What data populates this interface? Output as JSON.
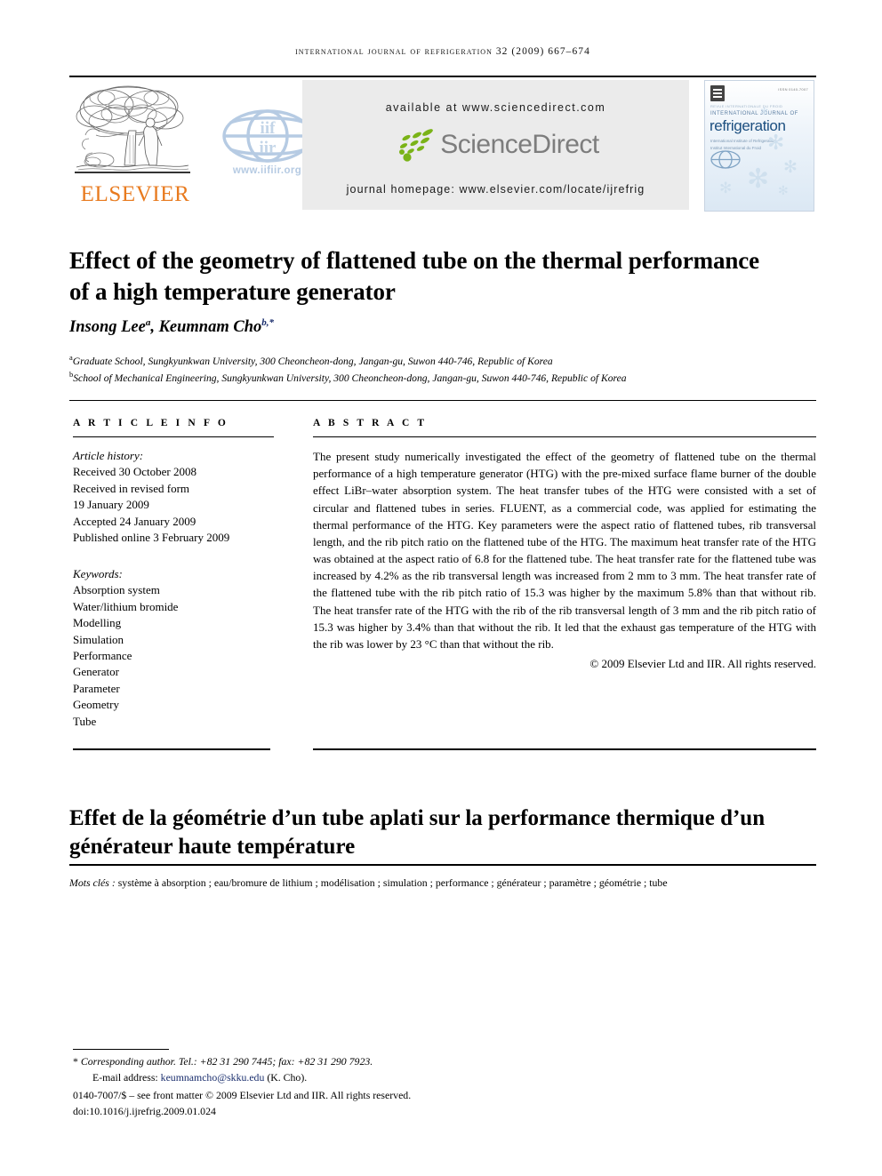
{
  "running_head": "International Journal of Refrigeration 32 (2009) 667–674",
  "masthead": {
    "elsevier_wordmark": "ELSEVIER",
    "iif_url": "www.iifiir.org",
    "iif_top_label": "iif",
    "iif_bottom_label": "iir",
    "sciencedirect": {
      "available_at": "available at www.sciencedirect.com",
      "logo_text": "ScienceDirect",
      "journal_homepage": "journal homepage: www.elsevier.com/locate/ijrefrig"
    },
    "cover": {
      "issn": "ISSN 0140-7007",
      "tiny_line": "REVUE INTERNATIONALE DU FROID",
      "intl_line": "INTERNATIONAL JOURNAL OF",
      "title": "refrigeration",
      "sub_line_1": "International Institute of Refrigeration",
      "sub_line_2": "Institut International du Froid",
      "publisher_mark": "iifiir"
    }
  },
  "article": {
    "title": "Effect of the geometry of flattened tube on the thermal performance of a high temperature generator",
    "authors": [
      {
        "name": "Insong Lee",
        "marker": "a"
      },
      {
        "name": "Keumnam Cho",
        "marker": "b,*"
      }
    ],
    "affiliations": [
      {
        "marker": "a",
        "text": "Graduate School, Sungkyunkwan University, 300 Cheoncheon-dong, Jangan-gu, Suwon 440-746, Republic of Korea"
      },
      {
        "marker": "b",
        "text": "School of Mechanical Engineering, Sungkyunkwan University, 300 Cheoncheon-dong, Jangan-gu, Suwon 440-746, Republic of Korea"
      }
    ]
  },
  "article_info": {
    "heading": "A R T I C L E   I N F O",
    "history_label": "Article history:",
    "history": [
      "Received 30 October 2008",
      "Received in revised form",
      "19 January 2009",
      "Accepted 24 January 2009",
      "Published online 3 February 2009"
    ],
    "keywords_label": "Keywords:",
    "keywords": [
      "Absorption system",
      "Water/lithium bromide",
      "Modelling",
      "Simulation",
      "Performance",
      "Generator",
      "Parameter",
      "Geometry",
      "Tube"
    ]
  },
  "abstract": {
    "heading": "A B S T R A C T",
    "body": "The present study numerically investigated the effect of the geometry of flattened tube on the thermal performance of a high temperature generator (HTG) with the pre-mixed surface flame burner of the double effect LiBr–water absorption system. The heat transfer tubes of the HTG were consisted with a set of circular and flattened tubes in series. FLUENT, as a commercial code, was applied for estimating the thermal performance of the HTG. Key parameters were the aspect ratio of flattened tubes, rib transversal length, and the rib pitch ratio on the flattened tube of the HTG. The maximum heat transfer rate of the HTG was obtained at the aspect ratio of 6.8 for the flattened tube. The heat transfer rate for the flattened tube was increased by 4.2% as the rib transversal length was increased from 2 mm to 3 mm. The heat transfer rate of the flattened tube with the rib pitch ratio of 15.3 was higher by the maximum 5.8% than that without rib. The heat transfer rate of the HTG with the rib of the rib transversal length of 3 mm and the rib pitch ratio of 15.3 was higher by 3.4% than that without the rib. It led that the exhaust gas temperature of the HTG with the rib was lower by 23 °C than that without the rib.",
    "copyright": "© 2009 Elsevier Ltd and IIR. All rights reserved."
  },
  "french": {
    "title": "Effet de la géométrie d’un tube aplati sur la performance thermique d’un générateur haute température",
    "keywords_label": "Mots clés :",
    "keywords_text": "système à absorption ; eau/bromure de lithium ; modélisation ; simulation ; performance ; générateur ; paramètre ; géométrie ; tube"
  },
  "footer": {
    "corresponding": "Corresponding author. Tel.: +82 31 290 7445; fax: +82 31 290 7923.",
    "star": "*",
    "email_label": "E-mail address:",
    "email": "keumnamcho@skku.edu",
    "email_owner": "(K. Cho).",
    "front_matter": "0140-7007/$ – see front matter © 2009 Elsevier Ltd and IIR. All rights reserved.",
    "doi": "doi:10.1016/j.ijrefrig.2009.01.024"
  },
  "colors": {
    "elsevier_orange": "#e87a1e",
    "sciencedirect_green": "#7ab317",
    "sciencedirect_gray": "#7d7d7d",
    "iif_blue": "#b6cbe3",
    "link_navy": "#1b2f6e",
    "panel_gray": "#ebebeb"
  }
}
